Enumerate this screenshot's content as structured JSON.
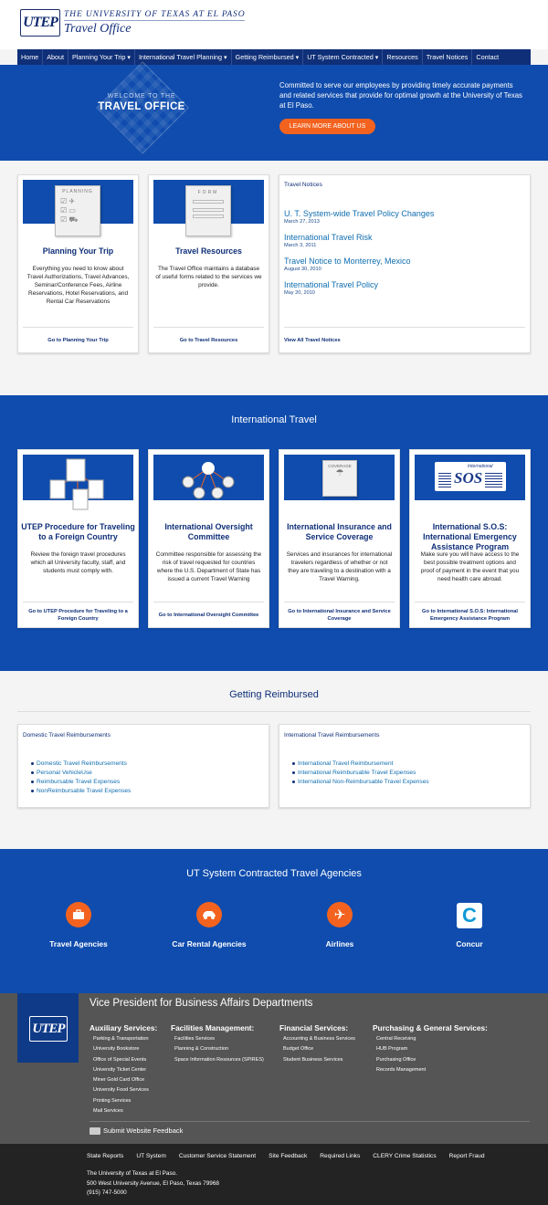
{
  "header": {
    "logo_text": "UTEP",
    "university": "THE UNIVERSITY OF TEXAS AT EL PASO",
    "office": "Travel Office"
  },
  "nav": [
    "Home",
    "About",
    "Planning Your Trip ▾",
    "International Travel Planning ▾",
    "Getting Reimbursed ▾",
    "UT System Contracted ▾",
    "Resources",
    "Travel Notices",
    "Contact"
  ],
  "hero": {
    "welcome_small": "WELCOME TO THE",
    "welcome_big": "TRAVEL OFFICE",
    "text": "Committed to serve our employees by providing timely accurate payments and related services that provide for optimal growth at the University of Texas at El Paso.",
    "button": "LEARN MORE ABOUT US"
  },
  "top_cards": [
    {
      "img_label": "PLANNING",
      "title": "Planning Your Trip",
      "body": "Everything you need to know about Travel Authorizations, Travel Advances, Seminar/Conference Fees, Airline Reservations, Hotel Reservations, and Rental Car Reservations",
      "link": "Go to Planning Your Trip"
    },
    {
      "img_label": "FORM",
      "title": "Travel Resources",
      "body": "The Travel Office maintains a database of useful forms related to the services we provide.",
      "link": "Go to Travel Resources"
    }
  ],
  "notices": {
    "heading": "Travel Notices",
    "items": [
      {
        "title": "U. T. System-wide Travel Policy Changes",
        "date": "March 27, 2013"
      },
      {
        "title": "International Travel Risk",
        "date": "March 3, 2011"
      },
      {
        "title": "Travel Notice to Monterrey, Mexico",
        "date": "August 30, 2010"
      },
      {
        "title": "International Travel Policy",
        "date": "May 20, 2010"
      }
    ],
    "link": "View All Travel Notices"
  },
  "international": {
    "title": "International Travel",
    "cards": [
      {
        "title": "UTEP Procedure for Traveling to a Foreign Country",
        "body": "Review the foreign travel procedures which all University faculty, staff, and students must comply with.",
        "link": "Go to UTEP Procedure for Traveling to a Foreign Country"
      },
      {
        "title": "International Oversight Committee",
        "body": "Committee responsible for assessing the risk of travel requested for countries where the U.S. Department of State has issued a current Travel Warning",
        "link": "Go to International Oversight Committee"
      },
      {
        "title": "International Insurance and Service Coverage",
        "body": "Services and insurances for international travelers regardless of whether or not they are traveling to a destination with a Travel Warning.",
        "link": "Go to International Insurance and Service Coverage",
        "img_label": "COVERAGE"
      },
      {
        "title": "International S.O.S: International Emergency Assistance Program",
        "body": "Make sure you will have access to the best possible treatment options and proof of payment in the event that you need health care abroad.",
        "link": "Go to International S.O.S: International Emergency Assistance Program",
        "img_label_small": "International",
        "img_label_big": "SOS"
      }
    ]
  },
  "reimbursed": {
    "title": "Getting Reimbursed",
    "domestic": {
      "heading": "Domestic Travel Reimbursements",
      "items": [
        "Domestic Travel Reimbursements",
        "Personal VehicleUse",
        "Reimbursable Travel Expenses",
        "NonReimbursable Travel Expenses"
      ]
    },
    "international": {
      "heading": "International Travel Reimbursements",
      "items": [
        "International Travel Reimbursement",
        "International Reimbursable Travel Expenses",
        "International Non-Reimbursable Travel Expenses"
      ]
    }
  },
  "agencies": {
    "title": "UT System Contracted Travel Agencies",
    "items": [
      {
        "label": "Travel Agencies",
        "icon": "briefcase-icon"
      },
      {
        "label": "Car Rental Agencies",
        "icon": "car-icon"
      },
      {
        "label": "Airlines",
        "icon": "airplane-icon"
      },
      {
        "label": "Concur",
        "icon": "concur-logo"
      }
    ]
  },
  "vp": {
    "title": "Vice President for Business Affairs Departments",
    "columns": [
      {
        "heading": "Auxiliary Services:",
        "items": [
          "Parking & Transportation",
          "University Bookstore",
          "Office of Special Events",
          "University Ticket Center",
          "Miner Gold Card Office",
          "University Food Services",
          "Printing Services",
          "Mail Services"
        ]
      },
      {
        "heading": "Facilities Management:",
        "items": [
          "Facilities Services",
          "Planning & Construction",
          "Space Information Resources (SPIRES)"
        ]
      },
      {
        "heading": "Financial Services:",
        "items": [
          "Accounting & Business Services",
          "Budget Office",
          "Student Business Services"
        ]
      },
      {
        "heading": "Purchasing & General Services:",
        "items": [
          "Central Receiving",
          "HUB Program",
          "Purchasing Office",
          "Records Management"
        ]
      }
    ],
    "feedback": "Submit Website Feedback"
  },
  "footer": {
    "links": [
      "State Reports",
      "UT System",
      "Customer Service Statement",
      "Site Feedback",
      "Required Links",
      "CLERY Crime Statistics",
      "Report Fraud"
    ],
    "address": [
      "The University of Texas at El Paso.",
      "500 West University Avenue,  El Paso, Texas 79968",
      "(915) 747-5000"
    ]
  },
  "colors": {
    "brand_blue": "#0f4cad",
    "nav_blue": "#0f2f78",
    "accent_orange": "#f3631f",
    "link_blue": "#106eb0"
  }
}
